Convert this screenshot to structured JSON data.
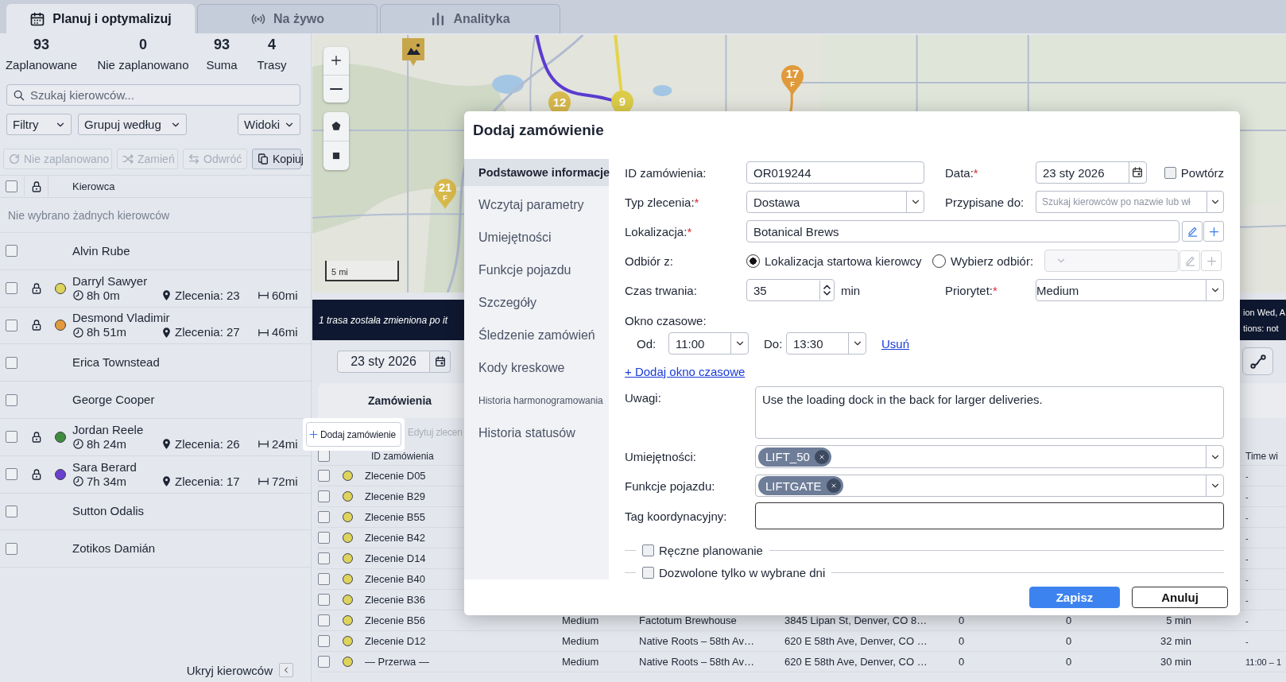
{
  "tabs": [
    {
      "label": "Planuj i optymalizuj",
      "selected": true
    },
    {
      "label": "Na żywo",
      "selected": false
    },
    {
      "label": "Analityka",
      "selected": false
    }
  ],
  "stats": [
    {
      "value": "93",
      "label": "Zaplanowane"
    },
    {
      "value": "0",
      "label": "Nie zaplanowano"
    },
    {
      "value": "93",
      "label": "Suma"
    },
    {
      "value": "4",
      "label": "Trasy"
    }
  ],
  "driver_search": {
    "placeholder": "Szukaj kierowców..."
  },
  "filters": [
    {
      "label": "Filtry"
    },
    {
      "label": "Grupuj według"
    }
  ],
  "views": {
    "label": "Widoki"
  },
  "toolbar": [
    {
      "label": "Nie zaplanowano",
      "disabled": true
    },
    {
      "label": "Zamień",
      "disabled": true
    },
    {
      "label": "Odwróć",
      "disabled": true
    },
    {
      "label": "Kopiuj",
      "disabled": false
    }
  ],
  "driver_table": {
    "all_checked": false,
    "column": "Kierowca",
    "empty_message": "Nie wybrano żadnych kierowców",
    "rows": [
      {
        "name": "Alvin Rube",
        "checked": false
      },
      {
        "name": "Darryl Sawyer",
        "checked": false,
        "route": {
          "color": "#ded35b",
          "duration": "8h 0m",
          "orders": "Zlecenia: 23",
          "distance": "60mi"
        }
      },
      {
        "name": "Desmond Vladimir",
        "checked": false,
        "route": {
          "color": "#e29a3c",
          "duration": "8h 51m",
          "orders": "Zlecenia: 27",
          "distance": "46mi"
        }
      },
      {
        "name": "Erica Townstead",
        "checked": false
      },
      {
        "name": "George Cooper",
        "checked": false
      },
      {
        "name": "Jordan Reele",
        "checked": false,
        "route": {
          "color": "#3e8c3e",
          "duration": "8h 24m",
          "orders": "Zlecenia: 26",
          "distance": "24mi"
        }
      },
      {
        "name": "Sara Berard",
        "checked": false,
        "route": {
          "color": "#6b3fd0",
          "duration": "7h 34m",
          "orders": "Zlecenia: 17",
          "distance": "72mi"
        }
      },
      {
        "name": "Sutton Odalis",
        "checked": false
      },
      {
        "name": "Zotikos Damián",
        "checked": false
      }
    ]
  },
  "hide_drivers": {
    "label": "Ukryj kierowców"
  },
  "map": {
    "scale": "5 mi",
    "markers": [
      {
        "kind": "depot",
        "color": "#c9a54a"
      },
      {
        "kind": "stop",
        "label": "12",
        "color": "#d8b94c"
      },
      {
        "kind": "stop",
        "label": "9",
        "color": "#dccc4a"
      },
      {
        "kind": "stop",
        "label": "17",
        "sub": "F",
        "color": "#e09a3a"
      },
      {
        "kind": "stop",
        "label": "21",
        "sub": "F",
        "color": "#d8b94c"
      }
    ]
  },
  "banner": {
    "text": "1 trasa została zmieniona po it",
    "right_lines": [
      "ion Wed, A",
      "tions: not"
    ]
  },
  "date_field": {
    "value": "23 sty 2026"
  },
  "orders_panel": {
    "tab": {
      "label": "Zamówienia",
      "selected": true
    },
    "add_button": "Dodaj zamówienie",
    "edit_button": {
      "label": "Edytuj zlecen",
      "disabled": true
    }
  },
  "orders_table": {
    "all_checked": false,
    "columns": {
      "id": "ID zamówienia",
      "column_10": "Time wi"
    },
    "rows": [
      {
        "checked": false,
        "color": "#ded35b",
        "id": "Zlecenie D05",
        "column_10": "-"
      },
      {
        "checked": false,
        "color": "#ded35b",
        "id": "Zlecenie B29",
        "column_10": "-"
      },
      {
        "checked": false,
        "color": "#ded35b",
        "id": "Zlecenie B55",
        "column_10": "-"
      },
      {
        "checked": false,
        "color": "#ded35b",
        "id": "Zlecenie B42",
        "column_10": "-"
      },
      {
        "checked": false,
        "color": "#ded35b",
        "id": "Zlecenie D14",
        "column_10": "-"
      },
      {
        "checked": false,
        "color": "#ded35b",
        "id": "Zlecenie B40",
        "column_10": "-"
      },
      {
        "checked": false,
        "color": "#ded35b",
        "id": "Zlecenie B36",
        "column_10": "-"
      },
      {
        "checked": false,
        "color": "#ded35b",
        "id": "Zlecenie B56",
        "column_4": "Medium",
        "column_5": "Factotum Brewhouse",
        "column_6": "3845 Lipan St, Denver, CO 8…",
        "column_7": "0",
        "column_8": "0",
        "column_9": "5 min",
        "column_10": "-"
      },
      {
        "checked": false,
        "color": "#ded35b",
        "id": "Zlecenie D12",
        "column_4": "Medium",
        "column_5": "Native Roots – 58th Av…",
        "column_6": "620 E 58th Ave, Denver, CO …",
        "column_7": "0",
        "column_8": "0",
        "column_9": "32 min",
        "column_10": "-"
      },
      {
        "checked": false,
        "color": "#ded35b",
        "id": "— Przerwa —",
        "column_4": "Medium",
        "column_5": "Native Roots – 58th Av…",
        "column_6": "620 E 58th Ave, Denver, CO …",
        "column_7": "0",
        "column_8": "0",
        "column_9": "30 min",
        "column_10": "11:00 – 1"
      }
    ]
  },
  "dialog": {
    "title": "Dodaj zamówienie",
    "sections": [
      {
        "label": "Podstawowe informacje",
        "kind": "normal",
        "selected": true
      },
      {
        "label": "Wczytaj parametry",
        "kind": "normal",
        "selected": false
      },
      {
        "label": "Umiejętności",
        "kind": "normal",
        "selected": false
      },
      {
        "label": "Funkcje pojazdu",
        "kind": "normal",
        "selected": false
      },
      {
        "label": "Szczegóły",
        "kind": "normal",
        "selected": false
      },
      {
        "label": "Śledzenie zamówień",
        "kind": "normal",
        "selected": false
      },
      {
        "label": "Kody kreskowe",
        "kind": "normal",
        "selected": false
      },
      {
        "label": "Historia harmonogramowania",
        "kind": "small",
        "selected": false
      },
      {
        "label": "Historia statusów",
        "kind": "normal",
        "selected": false
      }
    ],
    "order_id": {
      "label": "ID zamówienia:",
      "value": "OR019244"
    },
    "date": {
      "label": "Data:",
      "required_mark": "*",
      "value": "23 sty 2026"
    },
    "repeat": {
      "label": "Powtórz",
      "checked": false
    },
    "order_type": {
      "label": "Typ zlecenia:",
      "required_mark": "*",
      "value": "Dostawa"
    },
    "assigned_to": {
      "label": "Przypisane do:",
      "placeholder": "Szukaj kierowców po nazwie lub wł"
    },
    "location": {
      "label": "Lokalizacja:",
      "required_mark": "*",
      "value": "Botanical Brews"
    },
    "pickup": {
      "label": "Odbiór z:",
      "options": [
        {
          "label": "Lokalizacja startowa kierowcy",
          "selected": true
        },
        {
          "label": "Wybierz odbiór:",
          "selected": false
        }
      ],
      "select_disabled": true
    },
    "duration": {
      "label": "Czas trwania:",
      "value": "35",
      "unit": "min"
    },
    "priority": {
      "label": "Priorytet:",
      "required_mark": "*",
      "value": "Medium"
    },
    "time_window": {
      "label": "Okno czasowe:",
      "from_label": "Od:",
      "from": "11:00",
      "to_label": "Do:",
      "to": "13:30",
      "remove": "Usuń",
      "add": "+ Dodaj okno czasowe"
    },
    "notes": {
      "label": "Uwagi:",
      "value": "Use the loading dock in the back for larger deliveries."
    },
    "skills": {
      "label": "Umiejętności:",
      "tags": [
        "LIFT_50"
      ]
    },
    "vehicle_features": {
      "label": "Funkcje pojazdu:",
      "tags": [
        "LIFTGATE"
      ]
    },
    "coordination_tag": {
      "label": "Tag koordynacyjny:"
    },
    "options": [
      {
        "label": "Ręczne planowanie",
        "checked": false
      },
      {
        "label": "Dozwolone tylko w wybrane dni",
        "checked": false
      }
    ],
    "buttons": [
      {
        "label": "Zapisz",
        "kind": "primary"
      },
      {
        "label": "Anuluj",
        "kind": "secondary"
      }
    ]
  }
}
